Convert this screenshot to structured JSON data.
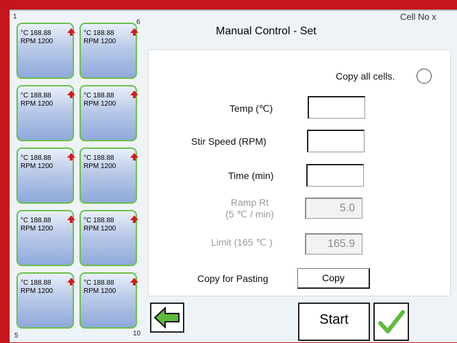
{
  "header": {
    "title": "Manual Control - Set",
    "cell_no": "Cell No  x"
  },
  "grid": {
    "corner_labels": {
      "top_left": "1",
      "top_right": "6",
      "bottom_left": "5",
      "bottom_right": "10"
    },
    "cells": [
      {
        "temp": "°C 188.88",
        "rpm": "RPM 1200"
      },
      {
        "temp": "°C 188.88",
        "rpm": "RPM 1200"
      },
      {
        "temp": "°C 188.88",
        "rpm": "RPM 1200"
      },
      {
        "temp": "°C 188.88",
        "rpm": "RPM 1200"
      },
      {
        "temp": "°C 188.88",
        "rpm": "RPM 1200"
      },
      {
        "temp": "°C 188.88",
        "rpm": "RPM 1200"
      },
      {
        "temp": "°C 188.88",
        "rpm": "RPM 1200"
      },
      {
        "temp": "°C 188.88",
        "rpm": "RPM 1200"
      },
      {
        "temp": "°C 188.88",
        "rpm": "RPM 1200"
      },
      {
        "temp": "°C 188.88",
        "rpm": "RPM 1200"
      }
    ],
    "arrow_icon": "arrow-up-icon",
    "border_color": "#6cc04a"
  },
  "form": {
    "copy_all_label": "Copy all cells.",
    "temp_label": "Temp (℃)",
    "stir_label": "Stir Speed (RPM)",
    "time_label": "Time (min)",
    "ramp_label_1": "Ramp Rt",
    "ramp_label_2": "(5 ℃ / min)",
    "ramp_value": "5.0",
    "limit_label": "Limit (165 ℃ )",
    "limit_value": "165.9",
    "copy_pasting_label": "Copy for Pasting",
    "copy_button": "Copy"
  },
  "footer": {
    "back_icon": "back-arrow-icon",
    "start_label": "Start",
    "confirm_icon": "checkmark-icon"
  },
  "colors": {
    "frame": "#c4161c",
    "accent_green": "#5dbb3a",
    "arrow_red": "#d6181e"
  }
}
